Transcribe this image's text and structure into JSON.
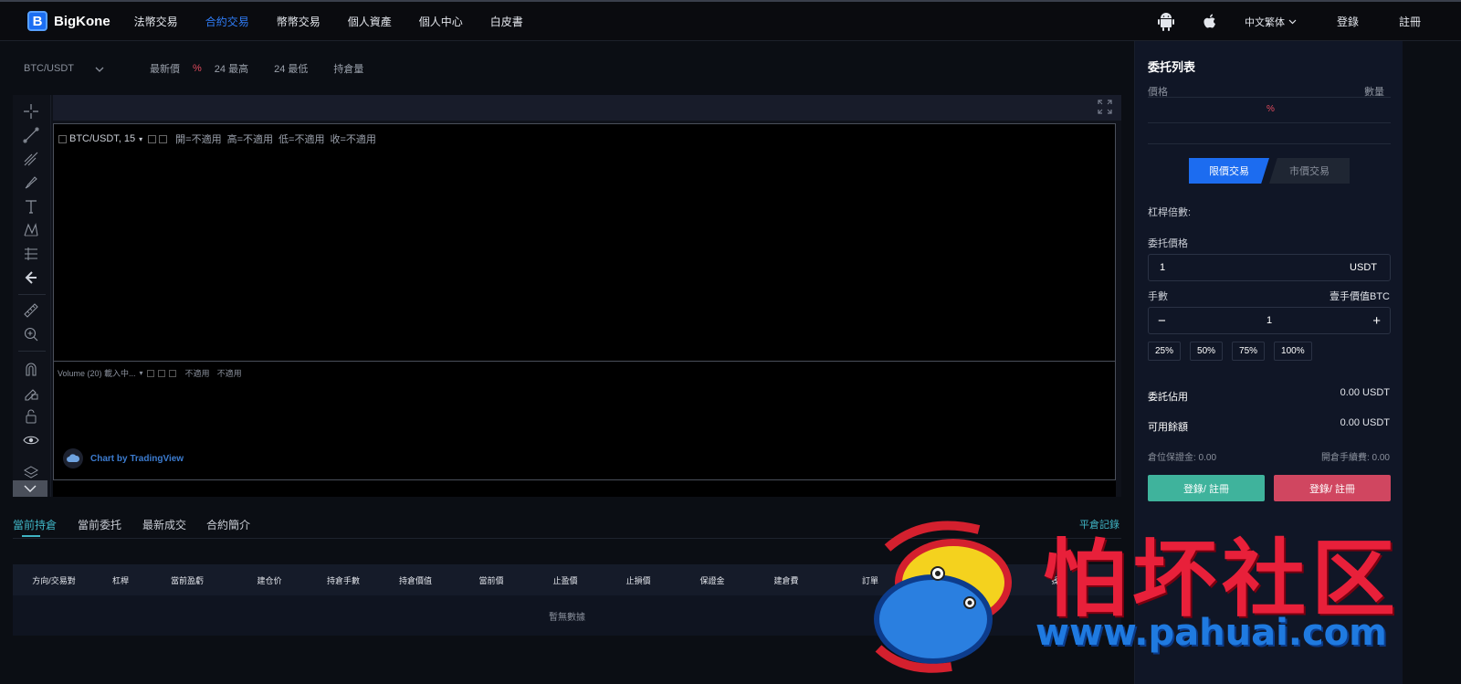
{
  "nav": {
    "logo": "BigKone",
    "items": [
      "法幣交易",
      "合約交易",
      "幣幣交易",
      "個人資產",
      "個人中心",
      "白皮書"
    ],
    "active_index": 1,
    "language": "中文繁体",
    "login": "登錄",
    "register": "註冊"
  },
  "ticker": {
    "pair": "BTC/USDT",
    "latest_label": "最新價",
    "pct": "%",
    "high_label": "24 最高",
    "low_label": "24 最低",
    "position_label": "持倉量"
  },
  "chart": {
    "symbol": "BTC/USDT, 15",
    "open": "開=不適用",
    "high": "高=不適用",
    "low": "低=不適用",
    "close": "收=不適用",
    "volume_label": "Volume (20) 載入中...",
    "vol_na1": "不適用",
    "vol_na2": "不適用",
    "tv_badge": "Chart by TradingView"
  },
  "tabs": {
    "items": [
      "當前持倉",
      "當前委托",
      "最新成交",
      "合約簡介"
    ],
    "active_index": 0,
    "right_link": "平倉記錄"
  },
  "table": {
    "headers": [
      "方向/交易對",
      "杠桿",
      "當前盈虧",
      "建仓价",
      "持倉手數",
      "持倉價值",
      "當前價",
      "止盈價",
      "止損價",
      "保證金",
      "建倉費",
      "訂單",
      "",
      "操"
    ],
    "empty": "暫無數據"
  },
  "panel": {
    "title": "委托列表",
    "price_label": "價格",
    "qty_label": "數量",
    "pct": "%",
    "limit_tab": "限價交易",
    "market_tab": "市價交易",
    "leverage_label": "杠桿倍數:",
    "order_price_label": "委托價格",
    "order_price_value": "1",
    "order_price_unit": "USDT",
    "lots_label": "手數",
    "lot_value_label": "壹手價值BTC",
    "lots_minus": "−",
    "lots_value": "1",
    "lots_plus": "+",
    "pct_buttons": [
      "25%",
      "50%",
      "75%",
      "100%"
    ],
    "occupied_label": "委託佔用",
    "occupied_value": "0.00 USDT",
    "available_label": "可用餘額",
    "available_value": "0.00 USDT",
    "margin_label": "倉位保證金: 0.00",
    "fee_label": "開倉手續費: 0.00",
    "buy_btn": "登錄/ 註冊",
    "sell_btn": "登錄/ 註冊"
  },
  "watermark": {
    "text": "怕坏社区",
    "url": "www.pahuai.com"
  },
  "colors": {
    "accent_blue": "#1c6cf0",
    "teal": "#3fb3c3",
    "buy_green": "#3fb39c",
    "sell_red": "#d04660"
  }
}
